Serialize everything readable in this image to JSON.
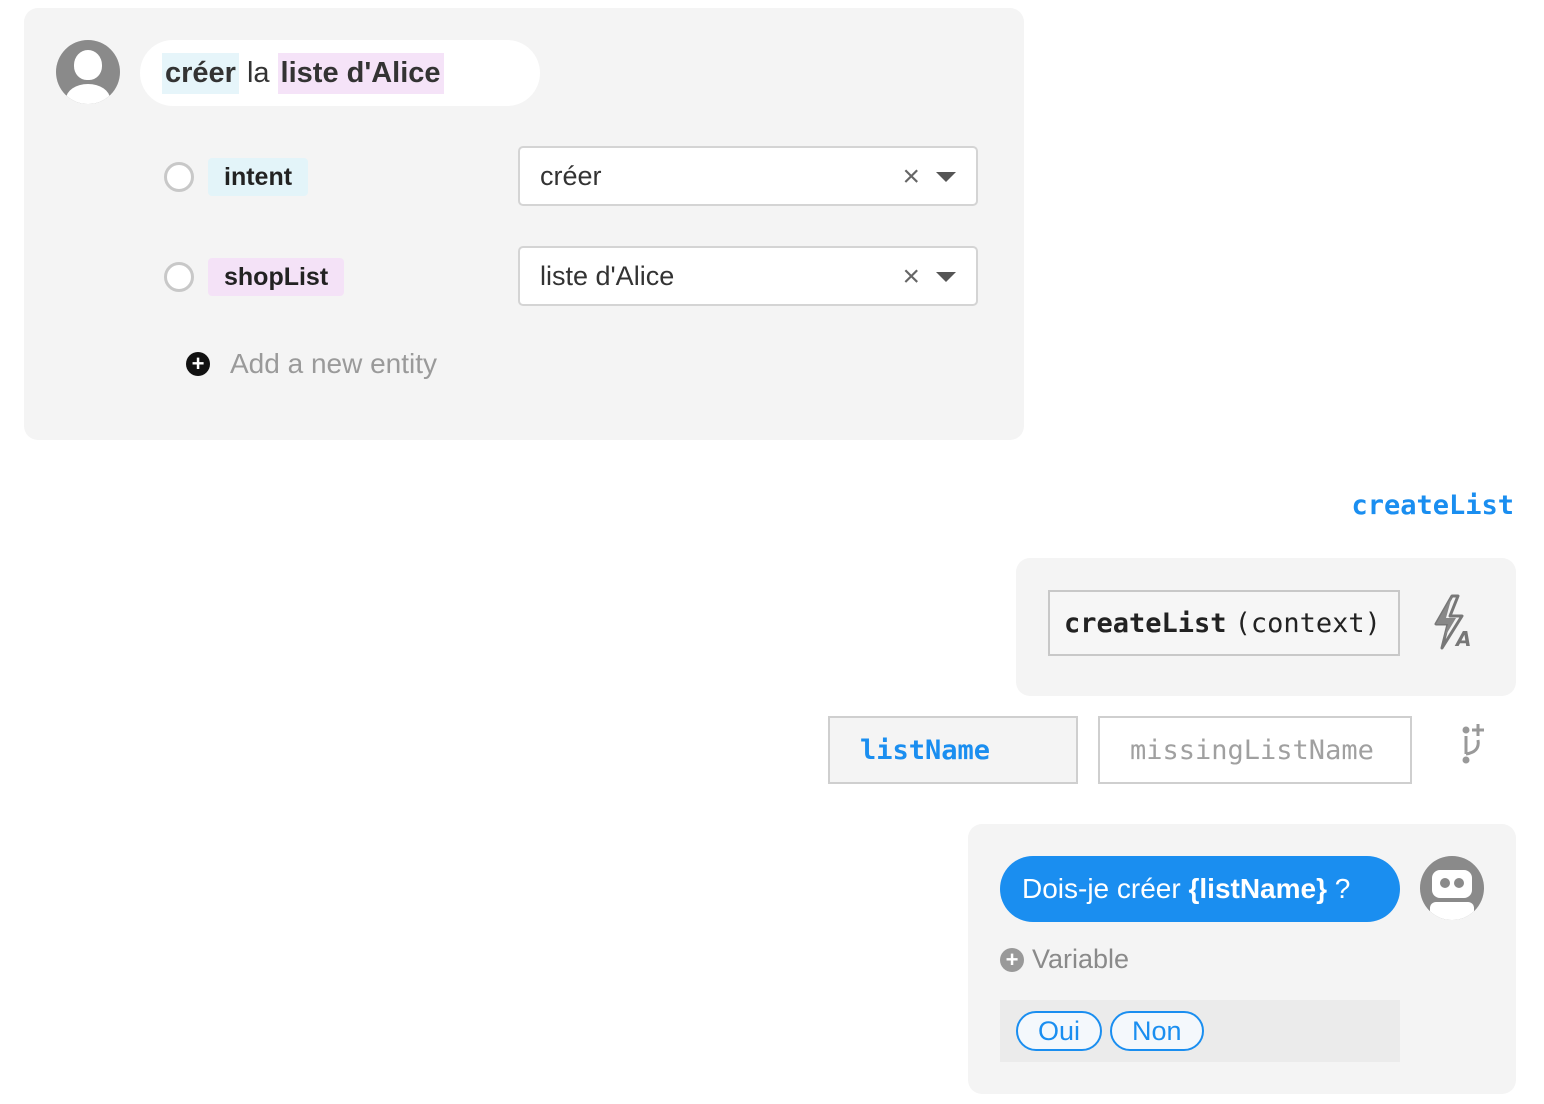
{
  "sentence": {
    "tokens": [
      {
        "text": "créer",
        "kind": "intent"
      },
      {
        "text": "la",
        "kind": "plain"
      },
      {
        "text": "liste d'Alice",
        "kind": "entity"
      }
    ]
  },
  "entities": [
    {
      "label": "intent",
      "value": "créer",
      "color": "#e3f4f9"
    },
    {
      "label": "shopList",
      "value": "liste d'Alice",
      "color": "#f4e2f7"
    }
  ],
  "add_entity_label": "Add a new entity",
  "story": {
    "name": "createList",
    "function_name": "createList",
    "function_args": "(context)"
  },
  "variables": {
    "set": "listName",
    "missing": "missingListName"
  },
  "bot": {
    "message_prefix": "Dois-je créer ",
    "message_var": "{listName}",
    "message_suffix": " ?",
    "add_variable_label": "Variable",
    "choices": [
      "Oui",
      "Non"
    ]
  },
  "colors": {
    "accent": "#1a8ef0",
    "panel_bg": "#f4f4f4"
  },
  "icons": {
    "clear": "×",
    "plus": "+"
  }
}
